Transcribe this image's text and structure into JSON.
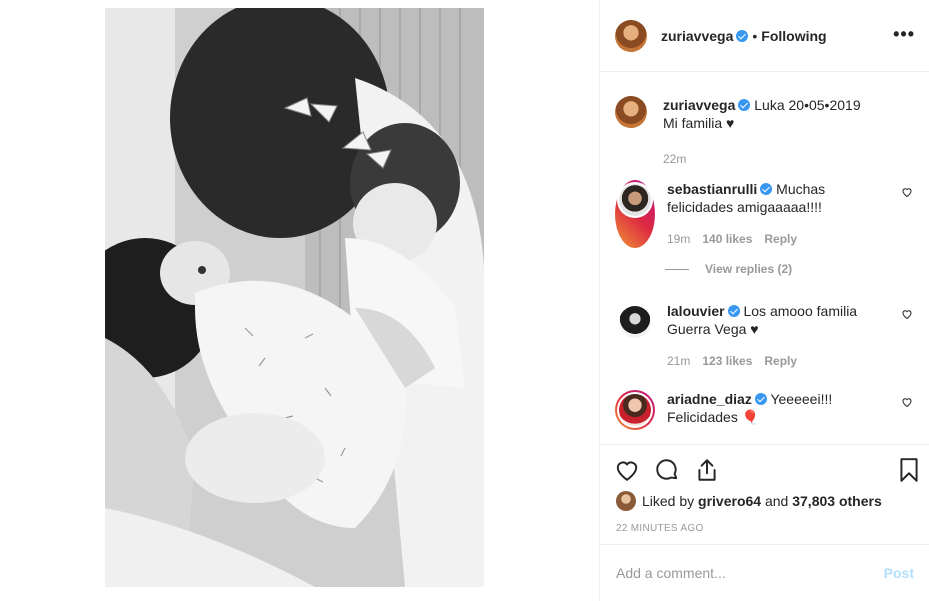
{
  "post": {
    "author": "zuriavvega",
    "following_label": "Following",
    "separator": "•",
    "more_label": "•••"
  },
  "caption": {
    "username": "zuriavvega",
    "text_line1": "Luka 20•05•2019",
    "text_line2": "Mi familia ♥",
    "time": "22m"
  },
  "comments": [
    {
      "username": "sebastianrulli",
      "text_line1": "Muchas",
      "text_line2": "felicidades amigaaaaa!!!!",
      "time": "19m",
      "likes": "140 likes",
      "reply": "Reply",
      "view_replies": "View replies (2)"
    },
    {
      "username": "lalouvier",
      "text_line1": "Los amooo familia",
      "text_line2": "Guerra Vega ♥",
      "time": "21m",
      "likes": "123 likes",
      "reply": "Reply"
    },
    {
      "username": "ariadne_diaz",
      "text_line1": "Yeeeeei!!!",
      "text_line2": "Felicidades 🎈",
      "time": "",
      "likes": "",
      "reply": ""
    }
  ],
  "likes": {
    "prefix": "Liked by",
    "user": "grivero64",
    "conjunction": "and",
    "others": "37,803 others"
  },
  "timestamp": "22 MINUTES AGO",
  "add_comment": {
    "placeholder": "Add a comment...",
    "post_label": "Post"
  },
  "colors": {
    "verified": "#3897f0",
    "post_disabled": "#b2dffc",
    "muted": "#999999"
  }
}
